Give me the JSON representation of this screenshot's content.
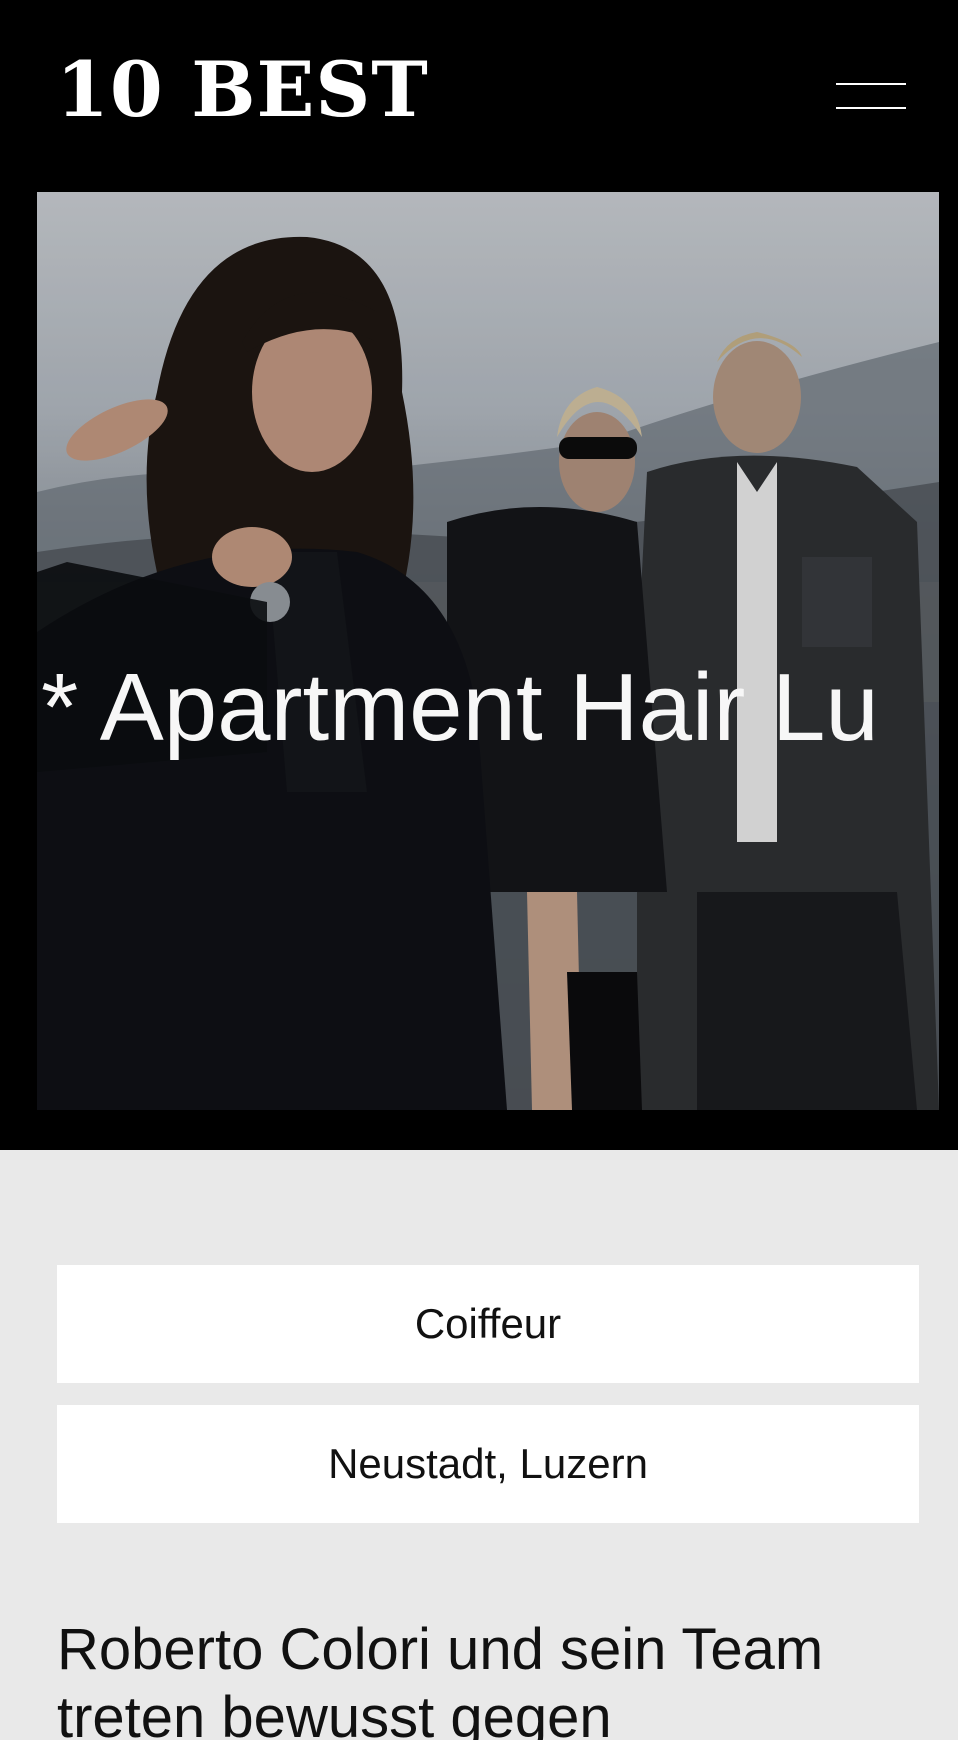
{
  "header": {
    "logo": "10 BEST",
    "menu_icon": "hamburger-menu-icon"
  },
  "hero": {
    "marquee_text": "* Apartment Hair Lu",
    "image": "fashion-editorial-photo"
  },
  "tags": [
    {
      "label": "Coiffeur"
    },
    {
      "label": "Neustadt, Luzern"
    }
  ],
  "main": {
    "intro_heading": "Roberto Colori und sein Team treten bewusst gegen"
  },
  "colors": {
    "header_bg": "#000000",
    "page_bg": "#e9e9e9",
    "chip_bg": "#ffffff",
    "text": "#111111"
  }
}
